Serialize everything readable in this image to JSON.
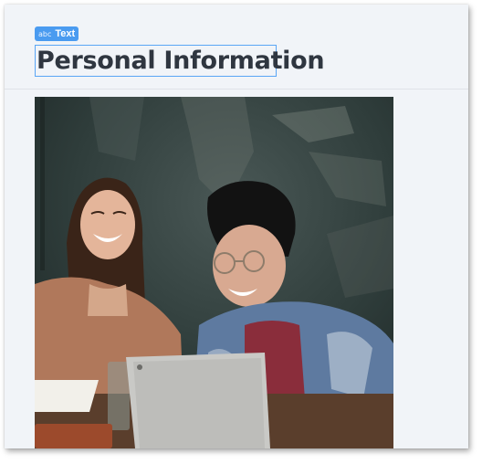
{
  "badge": {
    "icon": "abc",
    "label": "Text"
  },
  "heading": "Personal Information",
  "image": {
    "subject": "photo-two-people-laughing-laptop"
  }
}
